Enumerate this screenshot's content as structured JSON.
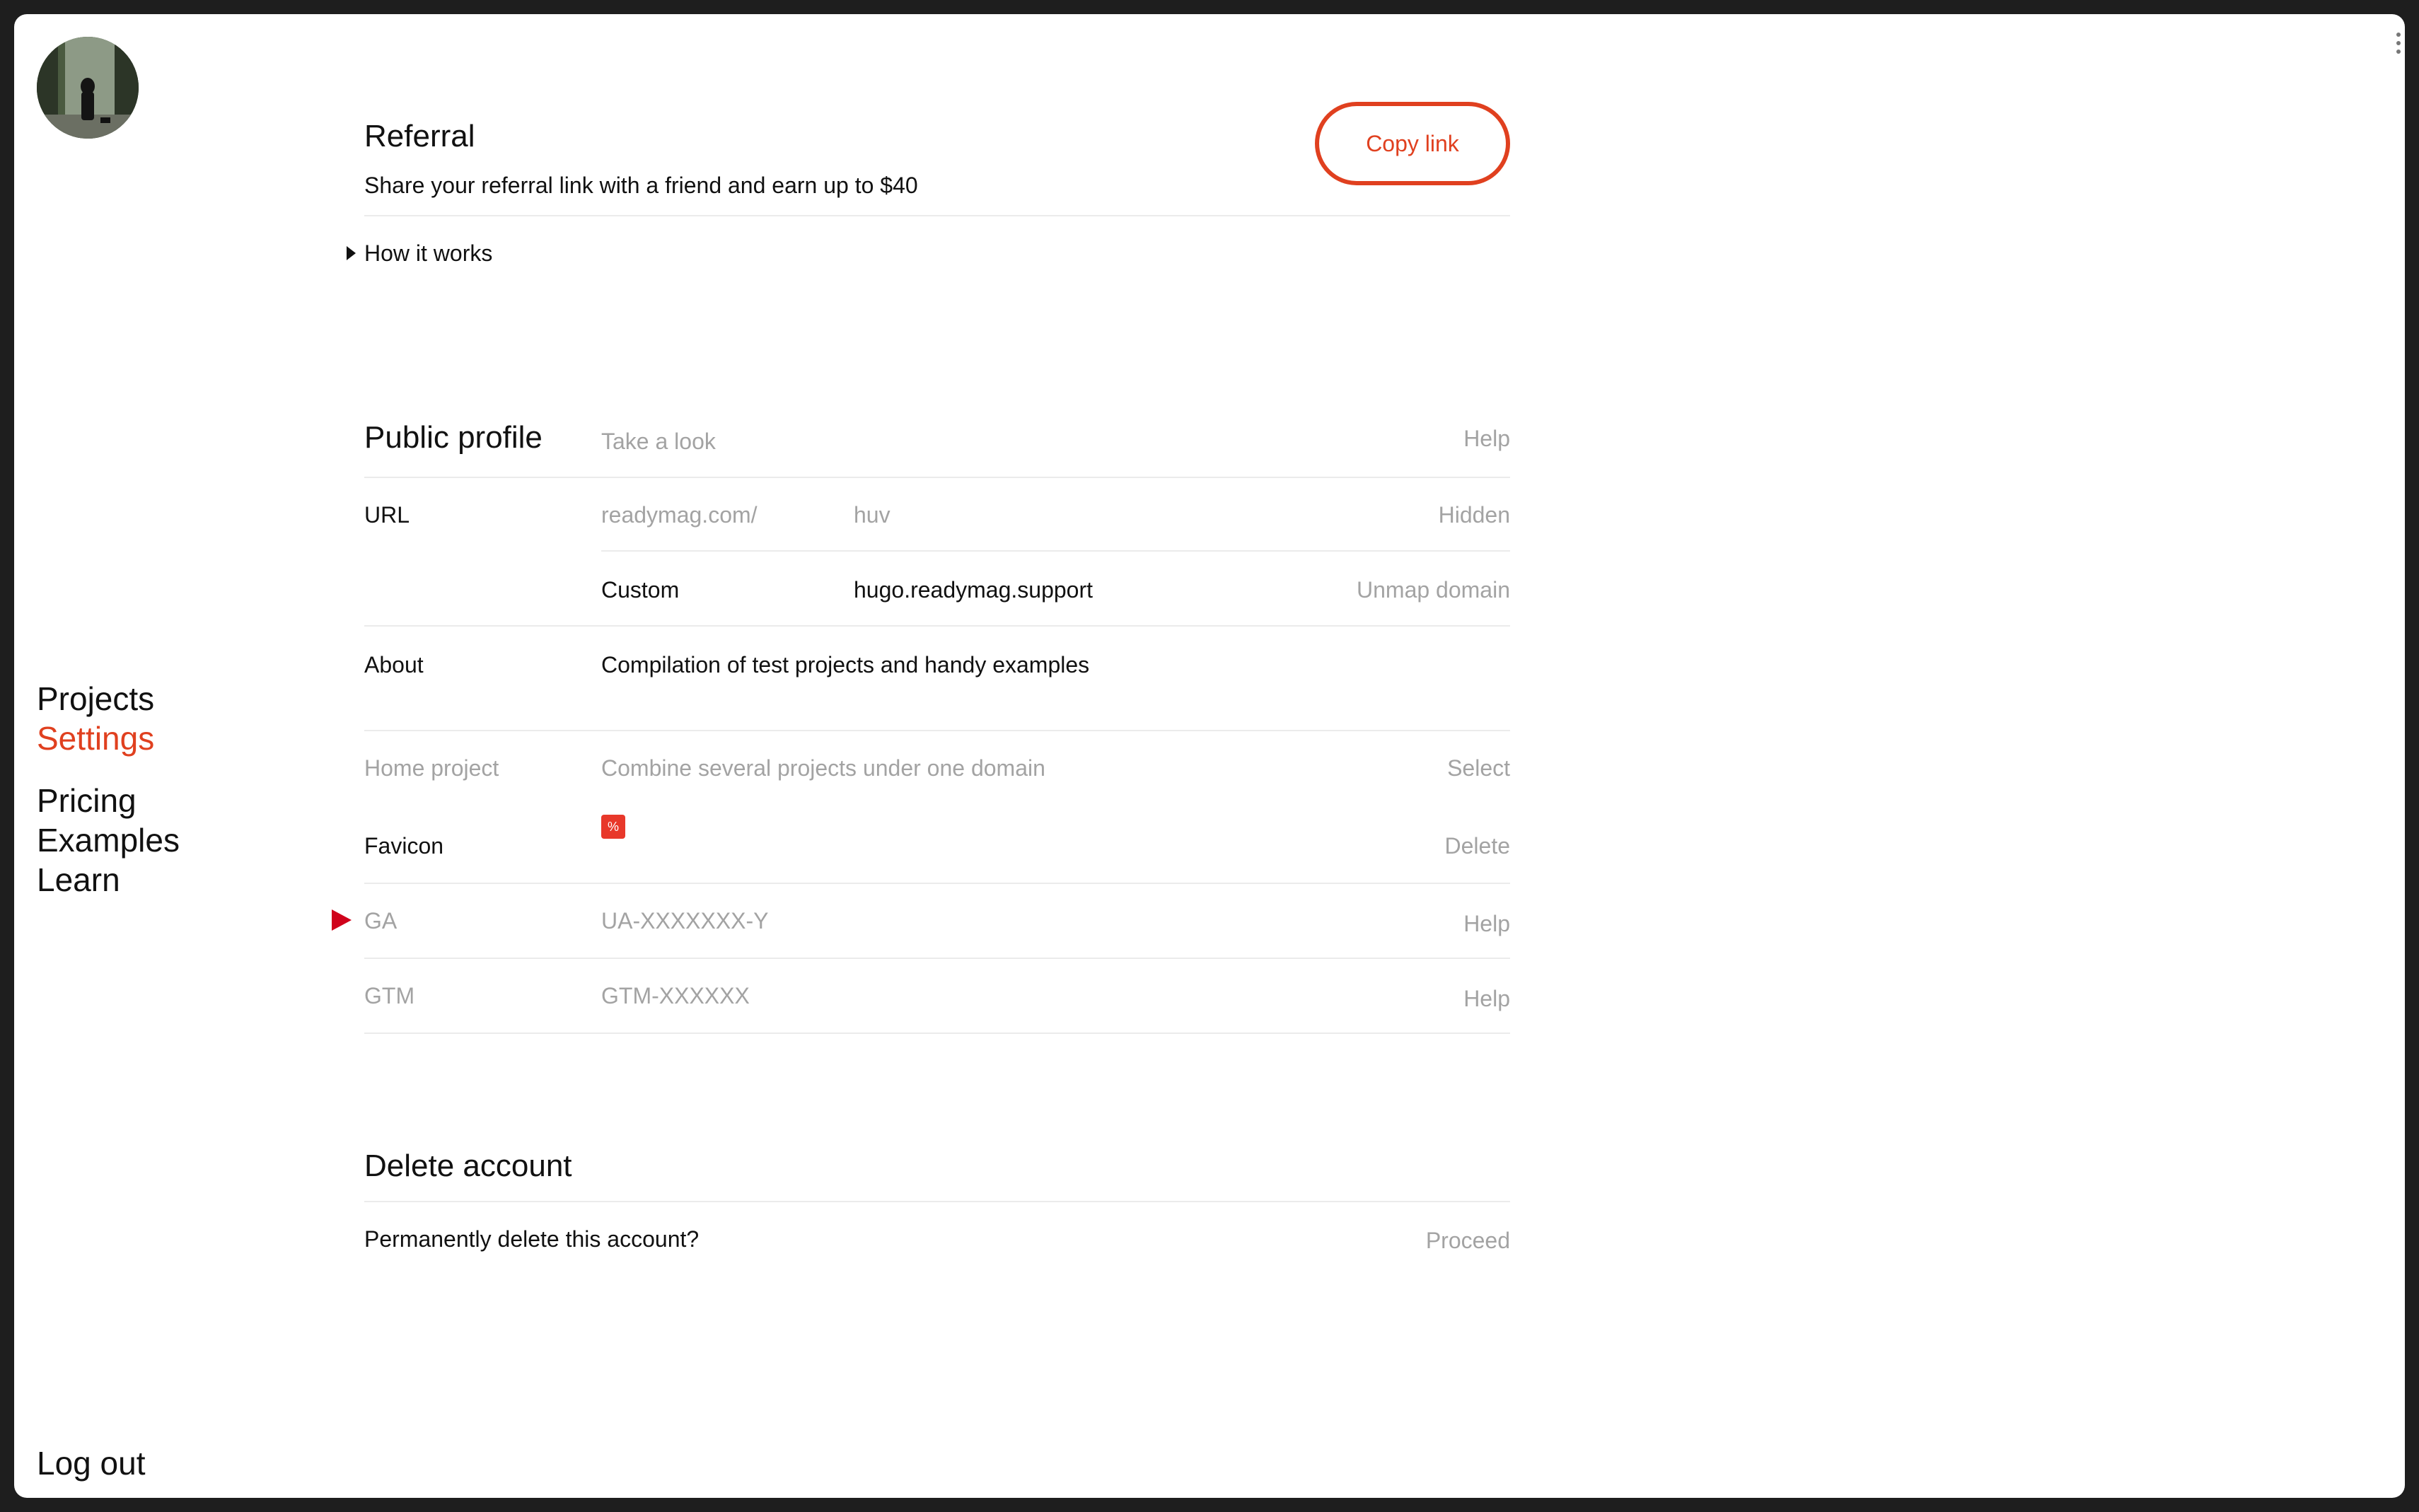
{
  "referral": {
    "title": "Referral",
    "description": "Share your referral link with a friend and earn up to $40",
    "copy_button": "Copy link",
    "how_it_works": "How it works"
  },
  "public_profile": {
    "title": "Public profile",
    "take_a_look": "Take a look",
    "help": "Help",
    "url": {
      "label": "URL",
      "prefix": "readymag.com/",
      "value": "huv",
      "status": "Hidden",
      "custom_label": "Custom",
      "custom_value": "hugo.readymag.support",
      "unmap": "Unmap domain"
    },
    "about": {
      "label": "About",
      "value": "Compilation of test projects and handy examples"
    },
    "home_project": {
      "label": "Home project",
      "placeholder": "Combine several projects under one domain",
      "action": "Select"
    },
    "favicon": {
      "label": "Favicon",
      "action": "Delete"
    },
    "ga": {
      "label": "GA",
      "placeholder": "UA-XXXXXXX-Y",
      "help": "Help"
    },
    "gtm": {
      "label": "GTM",
      "placeholder": "GTM-XXXXXX",
      "help": "Help"
    }
  },
  "delete_account": {
    "title": "Delete account",
    "question": "Permanently delete this account?",
    "action": "Proceed"
  },
  "nav": {
    "projects": "Projects",
    "settings": "Settings",
    "pricing": "Pricing",
    "examples": "Examples",
    "learn": "Learn",
    "logout": "Log out"
  },
  "colors": {
    "accent": "#e0401f",
    "ga_marker": "#d0021b",
    "muted_text": "#a3a3a3",
    "divider": "#ebebeb"
  }
}
